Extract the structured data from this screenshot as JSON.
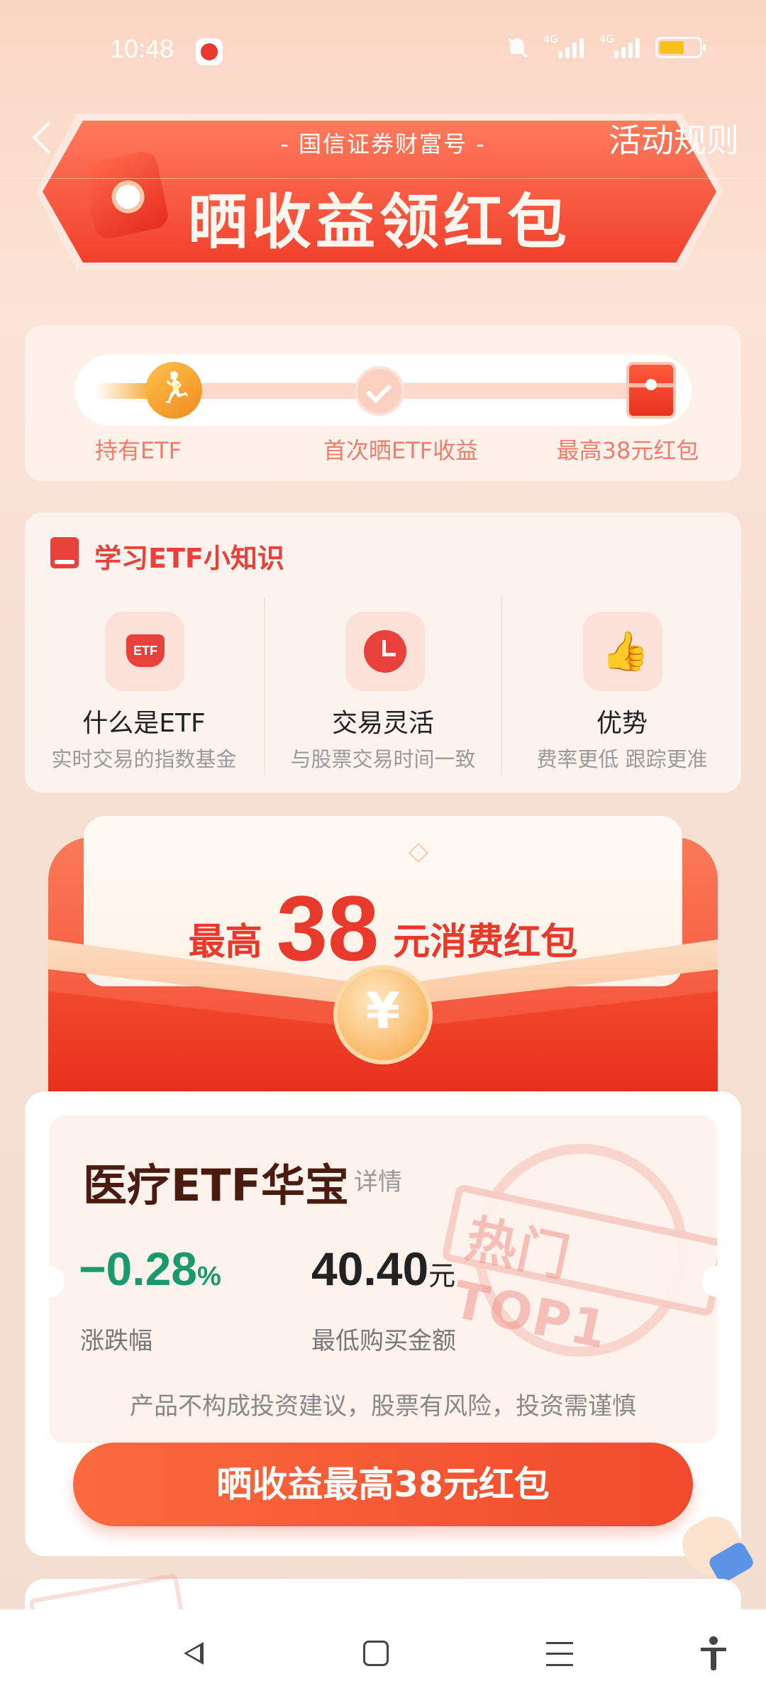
{
  "status_bar": {
    "time": "10:48",
    "network_1": "4G",
    "network_2": "4G"
  },
  "header": {
    "subtitle": "- 国信证券财富号 -",
    "rules_link": "活动规则"
  },
  "banner": {
    "title": "晒收益领红包"
  },
  "progress": {
    "current_step": 1,
    "steps": [
      {
        "label": "持有ETF",
        "icon": "runner-icon"
      },
      {
        "label": "首次晒ETF收益",
        "icon": "check-icon"
      },
      {
        "label": "最高38元红包",
        "icon": "red-envelope-icon"
      }
    ]
  },
  "knowledge": {
    "title": "学习ETF小知识",
    "items": [
      {
        "name": "什么是ETF",
        "desc": "实时交易的指数基金",
        "icon": "etf-icon"
      },
      {
        "name": "交易灵活",
        "desc": "与股票交易时间一致",
        "icon": "clock-icon"
      },
      {
        "name": "优势",
        "desc": "费率更低 跟踪更准",
        "icon": "thumbs-up-icon"
      }
    ]
  },
  "red_envelope": {
    "prefix": "最高",
    "amount": "38",
    "suffix": "元消费红包"
  },
  "product": {
    "name": "医疗ETF华宝",
    "detail_link": "详情",
    "badge": "热门TOP1",
    "change_value": "−0.28",
    "change_unit": "%",
    "change_label": "涨跌幅",
    "change_color": "#1a9a6c",
    "price_value": "40.40",
    "price_unit": "元",
    "price_label": "最低购买金额",
    "disclaimer": "产品不构成投资建议，股票有风险，投资需谨慎",
    "cta_label": "晒收益最高38元红包"
  },
  "colors": {
    "accent": "#e8403a",
    "button": "#f04a2c"
  }
}
